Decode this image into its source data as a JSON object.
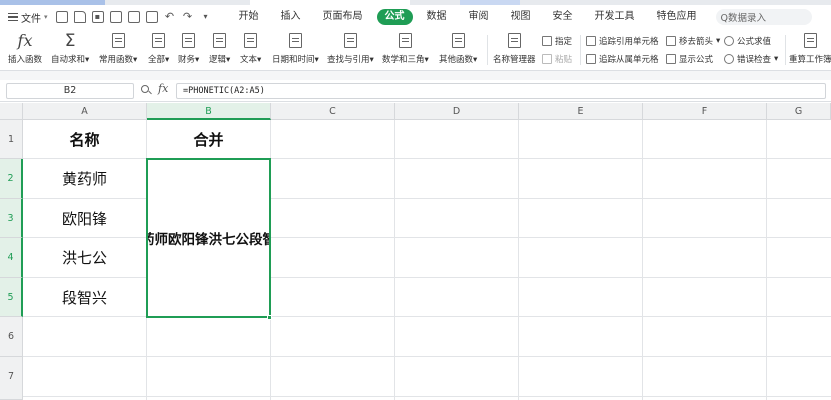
{
  "menubar": {
    "file_label": "文件",
    "tabs": [
      "开始",
      "插入",
      "页面布局",
      "公式",
      "数据",
      "审阅",
      "视图",
      "安全",
      "开发工具",
      "特色应用"
    ],
    "active_tab": "公式",
    "search_placeholder": "Q数据录入"
  },
  "ribbon": {
    "insert_function": "插入函数",
    "autosum": "自动求和",
    "common_functions": "常用函数",
    "all": "全部",
    "finance": "财务",
    "logic": "逻辑",
    "text": "文本",
    "datetime": "日期和时间",
    "lookup": "查找与引用",
    "math_trig": "数学和三角",
    "other_functions": "其他函数",
    "name_manager": "名称管理器",
    "define": "指定",
    "paste": "粘贴",
    "trace_precedents": "追踪引用单元格",
    "trace_dependents": "追踪从属单元格",
    "remove_arrows": "移去箭头",
    "show_formulas": "显示公式",
    "eval_formula": "公式求值",
    "error_check": "错误检查",
    "recalc": "重算工作簿"
  },
  "formula_bar": {
    "cell_ref": "B2",
    "fx": "fx",
    "formula": "=PHONETIC(A2:A5)"
  },
  "sheet": {
    "columns": [
      "A",
      "B",
      "C",
      "D",
      "E",
      "F",
      "G"
    ],
    "rows": [
      "1",
      "2",
      "3",
      "4",
      "5",
      "6",
      "7"
    ],
    "a1": "名称",
    "b1": "合并",
    "names": [
      "黄药师",
      "欧阳锋",
      "洪七公",
      "段智兴"
    ],
    "merged_value": "黄药师欧阳锋洪七公段智兴"
  },
  "colors": {
    "accent": "#1f9d55",
    "header_bg": "#f0f1f2",
    "grid_line": "#e2e4e7"
  }
}
